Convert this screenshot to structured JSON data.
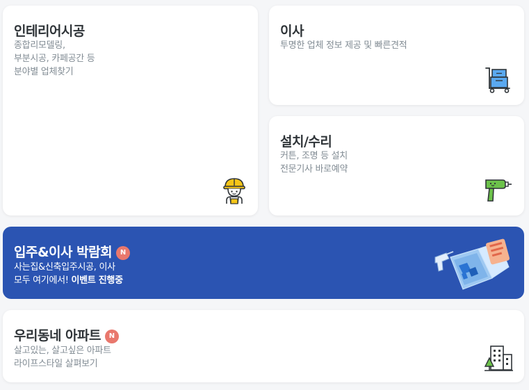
{
  "interior": {
    "title": "인테리어시공",
    "desc": [
      "종합리모델링,",
      "부분시공, 카페공간 등",
      "분야별 업체찾기"
    ],
    "icon": "worker-helmet-icon"
  },
  "moving": {
    "title": "이사",
    "desc": [
      "투명한 업체 정보 제공 및 빠른견적"
    ],
    "icon": "moving-cart-icon"
  },
  "install": {
    "title": "설치/수리",
    "desc": [
      "커튼, 조명 등 설치",
      "전문기사 바로예약"
    ],
    "icon": "power-drill-icon"
  },
  "expo": {
    "title": "입주&이사 박람회",
    "badge": "N",
    "desc1": "사는집&신축입주시공, 이사",
    "desc2_prefix": "모두 여기에서! ",
    "desc2_bold": "이벤트 진행중",
    "icon": "expo-illustration-icon",
    "bg_color": "#2b54b2"
  },
  "apartment": {
    "title": "우리동네 아파트",
    "badge": "N",
    "desc": [
      "살고있는, 살고싶은 아파트",
      "라이프스타일 살펴보기"
    ],
    "icon": "apartment-buildings-icon"
  },
  "colors": {
    "badge": "#e9786d",
    "title": "#2f3438",
    "desc": "#828c94"
  }
}
